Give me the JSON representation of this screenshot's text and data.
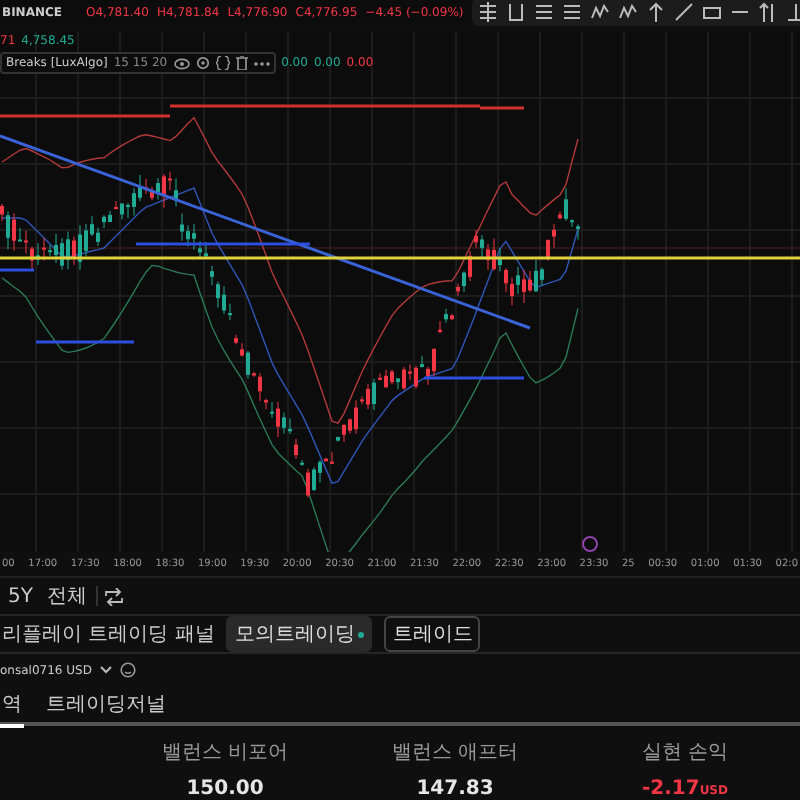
{
  "header": {
    "exchange": "BINANCE",
    "quotes": [
      {
        "text": "O4,781.40",
        "negative": true
      },
      {
        "text": "H4,781.84",
        "negative": true
      },
      {
        "text": "L4,776.90",
        "negative": true
      },
      {
        "text": "C4,776.95",
        "negative": true
      },
      {
        "text": "−4.45 (−0.09%)",
        "negative": true
      }
    ]
  },
  "price_line": [
    {
      "text": "71",
      "negative": true
    },
    {
      "text": "4,758.45",
      "negative": false
    }
  ],
  "indicator": {
    "name": "Breaks [LuxAlgo]",
    "params": "15 15 20",
    "values": [
      {
        "text": "0.00",
        "negative": false
      },
      {
        "text": "0.00",
        "negative": false
      },
      {
        "text": "0.00",
        "negative": true
      }
    ]
  },
  "time_axis": [
    "00",
    "17:00",
    "17:30",
    "18:00",
    "18:30",
    "19:00",
    "19:30",
    "20:00",
    "20:30",
    "21:00",
    "21:30",
    "22:00",
    "22:30",
    "23:00",
    "23:30",
    "25",
    "00:30",
    "01:00",
    "01:30",
    "02:0"
  ],
  "ranges": [
    "5Y",
    "전체"
  ],
  "panel": {
    "title": "리플레이 트레이딩 패널",
    "tabs": [
      {
        "label": "모의트레이딩",
        "selected": true
      },
      {
        "label": "트레이드",
        "selected": false
      }
    ]
  },
  "account": {
    "name": "onsal0716 USD"
  },
  "subtabs": [
    {
      "label": "역",
      "selected": true
    },
    {
      "label": "트레이딩저널",
      "selected": false
    }
  ],
  "table": {
    "columns": [
      "밸런스 비포어",
      "밸런스 애프터",
      "실현 손익"
    ],
    "values": [
      {
        "text": "150.00",
        "negative": false
      },
      {
        "text": "147.83",
        "negative": false
      },
      {
        "text": "-2.17",
        "unit": "USD",
        "negative": true
      }
    ]
  }
}
